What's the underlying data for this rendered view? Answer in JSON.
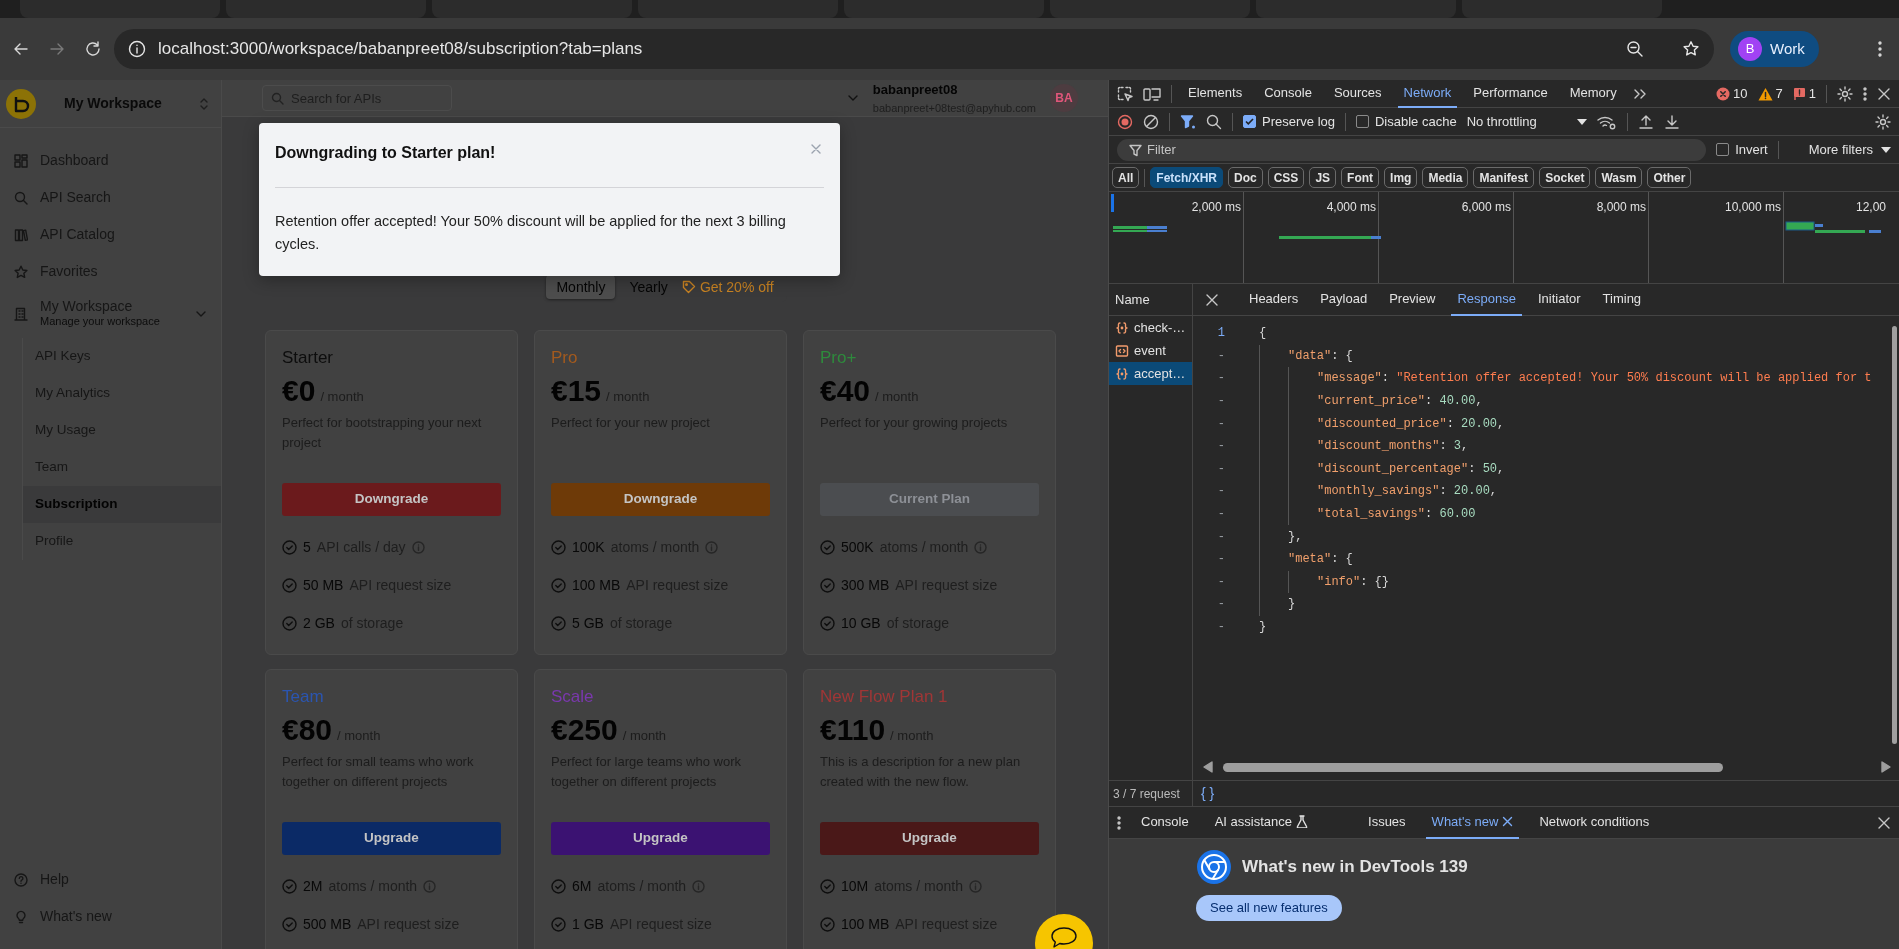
{
  "browser": {
    "url": "localhost:3000/workspace/babanpreet08/subscription?tab=plans",
    "profile": {
      "initial": "B",
      "label": "Work"
    }
  },
  "sidebar": {
    "workspace": "My Workspace",
    "items": [
      {
        "label": "Dashboard",
        "selected": false
      },
      {
        "label": "API Search",
        "selected": false
      },
      {
        "label": "API Catalog",
        "selected": false
      },
      {
        "label": "Favorites",
        "selected": false
      }
    ],
    "workspace_group": {
      "label": "My Workspace",
      "subtitle": "Manage your workspace",
      "expanded": true,
      "children": [
        {
          "label": "API Keys",
          "selected": false
        },
        {
          "label": "My Analytics",
          "selected": false
        },
        {
          "label": "My Usage",
          "selected": false
        },
        {
          "label": "Team",
          "selected": false
        },
        {
          "label": "Subscription",
          "selected": true
        },
        {
          "label": "Profile",
          "selected": false
        }
      ]
    },
    "footer_items": [
      {
        "label": "Help"
      },
      {
        "label": "What's new"
      }
    ]
  },
  "header": {
    "search_placeholder": "Search for APIs",
    "user_name": "babanpreet08",
    "user_email": "babanpreet+08test@apyhub.com",
    "avatar_initials": "BA"
  },
  "billing": {
    "options": [
      {
        "label": "Monthly",
        "selected": true
      },
      {
        "label": "Yearly",
        "selected": false
      }
    ],
    "promo": "Get 20% off"
  },
  "plans": [
    {
      "name": "Starter",
      "color": "#0d0d0d",
      "price": "€0",
      "period": "/ month",
      "description": "Perfect for bootstrapping your next project",
      "button": {
        "label": "Downgrade",
        "current": false,
        "color": "#6b1a1c"
      },
      "features": [
        {
          "value": "5",
          "label": "API calls / day",
          "info": true
        },
        {
          "value": "50 MB",
          "label": "API request size",
          "info": false
        },
        {
          "value": "2 GB",
          "label": "of storage",
          "info": false
        }
      ]
    },
    {
      "name": "Pro",
      "color": "#a35a1e",
      "price": "€15",
      "period": "/ month",
      "description": "Perfect for your new project",
      "button": {
        "label": "Downgrade",
        "current": false,
        "color": "#6e3a08"
      },
      "features": [
        {
          "value": "100K",
          "label": "atoms / month",
          "info": true
        },
        {
          "value": "100 MB",
          "label": "API request size",
          "info": false
        },
        {
          "value": "5 GB",
          "label": "of storage",
          "info": false
        }
      ]
    },
    {
      "name": "Pro+",
      "color": "#2e8a3c",
      "price": "€40",
      "period": "/ month",
      "description": "Perfect for your growing projects",
      "button": {
        "label": "Current Plan",
        "current": true,
        "color": "#4b4d50"
      },
      "features": [
        {
          "value": "500K",
          "label": "atoms / month",
          "info": true
        },
        {
          "value": "300 MB",
          "label": "API request size",
          "info": false
        },
        {
          "value": "10 GB",
          "label": "of storage",
          "info": false
        }
      ]
    },
    {
      "name": "Team",
      "color": "#2b55b0",
      "price": "€80",
      "period": "/ month",
      "description": "Perfect for small teams who work together on different projects",
      "button": {
        "label": "Upgrade",
        "current": false,
        "color": "#0b2a66"
      },
      "features": [
        {
          "value": "2M",
          "label": "atoms / month",
          "info": true
        },
        {
          "value": "500 MB",
          "label": "API request size",
          "info": false
        }
      ]
    },
    {
      "name": "Scale",
      "color": "#7a38ad",
      "price": "€250",
      "period": "/ month",
      "description": "Perfect for large teams who work together on different projects",
      "button": {
        "label": "Upgrade",
        "current": false,
        "color": "#3b1272"
      },
      "features": [
        {
          "value": "6M",
          "label": "atoms / month",
          "info": true
        },
        {
          "value": "1 GB",
          "label": "API request size",
          "info": false
        }
      ]
    },
    {
      "name": "New Flow Plan 1",
      "color": "#a03636",
      "price": "€110",
      "period": "/ month",
      "description": "This is a description for a new plan created with the new flow.",
      "button": {
        "label": "Upgrade",
        "current": false,
        "color": "#4a1818"
      },
      "features": [
        {
          "value": "10M",
          "label": "atoms / month",
          "info": true
        },
        {
          "value": "100 MB",
          "label": "API request size",
          "info": false
        }
      ]
    }
  ],
  "modal": {
    "title": "Downgrading to Starter plan!",
    "message": "Retention offer accepted! Your 50% discount will be applied for the next 3 billing cycles."
  },
  "devtools": {
    "tabs": [
      {
        "label": "Elements",
        "selected": false
      },
      {
        "label": "Console",
        "selected": false
      },
      {
        "label": "Sources",
        "selected": false
      },
      {
        "label": "Network",
        "selected": true
      },
      {
        "label": "Performance",
        "selected": false
      },
      {
        "label": "Memory",
        "selected": false
      }
    ],
    "errors": "10",
    "warnings": "7",
    "issues": "1",
    "preserve_log": {
      "label": "Preserve log",
      "checked": true
    },
    "disable_cache": {
      "label": "Disable cache",
      "checked": false
    },
    "throttling": "No throttling",
    "filter_placeholder": "Filter",
    "invert": {
      "label": "Invert",
      "checked": false
    },
    "more_filters": "More filters",
    "type_filters": [
      {
        "label": "All",
        "selected": false
      },
      {
        "label": "Fetch/XHR",
        "selected": true
      },
      {
        "label": "Doc",
        "selected": false
      },
      {
        "label": "CSS",
        "selected": false
      },
      {
        "label": "JS",
        "selected": false
      },
      {
        "label": "Font",
        "selected": false
      },
      {
        "label": "Img",
        "selected": false
      },
      {
        "label": "Media",
        "selected": false
      },
      {
        "label": "Manifest",
        "selected": false
      },
      {
        "label": "Socket",
        "selected": false
      },
      {
        "label": "Wasm",
        "selected": false
      },
      {
        "label": "Other",
        "selected": false
      }
    ],
    "timeline_ticks": [
      "2,000 ms",
      "4,000 ms",
      "6,000 ms",
      "8,000 ms",
      "10,000 ms",
      "12,00"
    ],
    "requests_header": "Name",
    "requests": [
      {
        "name": "check-…",
        "kind": "fetch",
        "selected": false
      },
      {
        "name": "event",
        "kind": "document",
        "selected": false
      },
      {
        "name": "accept…",
        "kind": "fetch",
        "selected": true
      }
    ],
    "detail_tabs": [
      {
        "label": "Headers",
        "selected": false
      },
      {
        "label": "Payload",
        "selected": false
      },
      {
        "label": "Preview",
        "selected": false
      },
      {
        "label": "Response",
        "selected": true
      },
      {
        "label": "Initiator",
        "selected": false
      },
      {
        "label": "Timing",
        "selected": false
      }
    ],
    "response": [
      {
        "gutter": "1",
        "tokens": [
          {
            "kind": "punct",
            "text": "{"
          }
        ],
        "children": [
          {
            "gutter": "-",
            "tokens": [
              {
                "kind": "key",
                "text": "\"data\""
              },
              {
                "kind": "punct",
                "text": ": {"
              }
            ],
            "children": [
              {
                "gutter": "-",
                "tokens": [
                  {
                    "kind": "key",
                    "text": "\"message\""
                  },
                  {
                    "kind": "punct",
                    "text": ": "
                  },
                  {
                    "kind": "string",
                    "text": "\"Retention offer accepted! Your 50% discount will be applied for t"
                  }
                ]
              },
              {
                "gutter": "-",
                "tokens": [
                  {
                    "kind": "key",
                    "text": "\"current_price\""
                  },
                  {
                    "kind": "punct",
                    "text": ": "
                  },
                  {
                    "kind": "number",
                    "text": "40.00"
                  },
                  {
                    "kind": "punct",
                    "text": ","
                  }
                ]
              },
              {
                "gutter": "-",
                "tokens": [
                  {
                    "kind": "key",
                    "text": "\"discounted_price\""
                  },
                  {
                    "kind": "punct",
                    "text": ": "
                  },
                  {
                    "kind": "number",
                    "text": "20.00"
                  },
                  {
                    "kind": "punct",
                    "text": ","
                  }
                ]
              },
              {
                "gutter": "-",
                "tokens": [
                  {
                    "kind": "key",
                    "text": "\"discount_months\""
                  },
                  {
                    "kind": "punct",
                    "text": ": "
                  },
                  {
                    "kind": "number",
                    "text": "3"
                  },
                  {
                    "kind": "punct",
                    "text": ","
                  }
                ]
              },
              {
                "gutter": "-",
                "tokens": [
                  {
                    "kind": "key",
                    "text": "\"discount_percentage\""
                  },
                  {
                    "kind": "punct",
                    "text": ": "
                  },
                  {
                    "kind": "number",
                    "text": "50"
                  },
                  {
                    "kind": "punct",
                    "text": ","
                  }
                ]
              },
              {
                "gutter": "-",
                "tokens": [
                  {
                    "kind": "key",
                    "text": "\"monthly_savings\""
                  },
                  {
                    "kind": "punct",
                    "text": ": "
                  },
                  {
                    "kind": "number",
                    "text": "20.00"
                  },
                  {
                    "kind": "punct",
                    "text": ","
                  }
                ]
              },
              {
                "gutter": "-",
                "tokens": [
                  {
                    "kind": "key",
                    "text": "\"total_savings\""
                  },
                  {
                    "kind": "punct",
                    "text": ": "
                  },
                  {
                    "kind": "number",
                    "text": "60.00"
                  }
                ]
              }
            ]
          },
          {
            "gutter": "-",
            "tokens": [
              {
                "kind": "punct",
                "text": "},"
              }
            ]
          },
          {
            "gutter": "-",
            "tokens": [
              {
                "kind": "key",
                "text": "\"meta\""
              },
              {
                "kind": "punct",
                "text": ": {"
              }
            ],
            "children": [
              {
                "gutter": "-",
                "tokens": [
                  {
                    "kind": "key",
                    "text": "\"info\""
                  },
                  {
                    "kind": "punct",
                    "text": ": {}"
                  }
                ]
              }
            ]
          },
          {
            "gutter": "-",
            "tokens": [
              {
                "kind": "punct",
                "text": "}"
              }
            ]
          }
        ]
      },
      {
        "gutter": "-",
        "tokens": [
          {
            "kind": "punct",
            "text": "}"
          }
        ]
      }
    ],
    "status": "3 / 7 request",
    "format_button": "{ }",
    "drawer_tabs": [
      {
        "label": "Console",
        "selected": false,
        "closable": false,
        "experimental": false
      },
      {
        "label": "AI assistance",
        "selected": false,
        "closable": false,
        "experimental": true
      },
      {
        "label": "Issues",
        "selected": false,
        "closable": false,
        "experimental": false
      },
      {
        "label": "What's new",
        "selected": true,
        "closable": true,
        "experimental": false
      },
      {
        "label": "Network conditions",
        "selected": false,
        "closable": false,
        "experimental": false
      }
    ],
    "whats_new": {
      "title": "What's new in DevTools 139",
      "button": "See all new features"
    }
  }
}
